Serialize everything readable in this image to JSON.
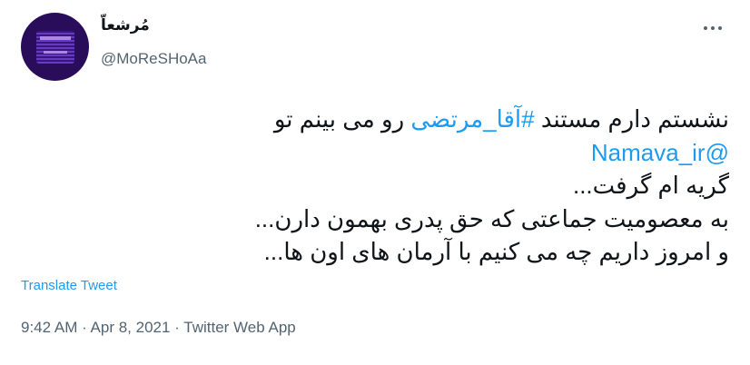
{
  "author": {
    "display_name": "مُرشعاّ",
    "handle": "@MoReSHoAa"
  },
  "tweet": {
    "line1_before": "نشستم دارم مستند ",
    "hashtag": "#آقا_مرتضی",
    "line1_after": " رو می بینم تو",
    "mention": "@Namava_ir",
    "line3": "گریه ام گرفت...",
    "line4": "به معصومیت جماعتی که حق پدری بهمون دارن...",
    "line5": "و امروز داریم چه می کنیم با آرمان های اون ها..."
  },
  "actions": {
    "translate_label": "Translate Tweet",
    "more_icon": "more-horizontal-icon"
  },
  "meta": {
    "time": "9:42 AM",
    "sep1": " · ",
    "date": "Apr 8, 2021",
    "sep2": " · ",
    "app": "Twitter Web App"
  },
  "colors": {
    "link": "#1d9bf0",
    "secondary_text": "#536471",
    "primary_text": "#0f1419",
    "avatar_bg": "#2a0d5a"
  }
}
